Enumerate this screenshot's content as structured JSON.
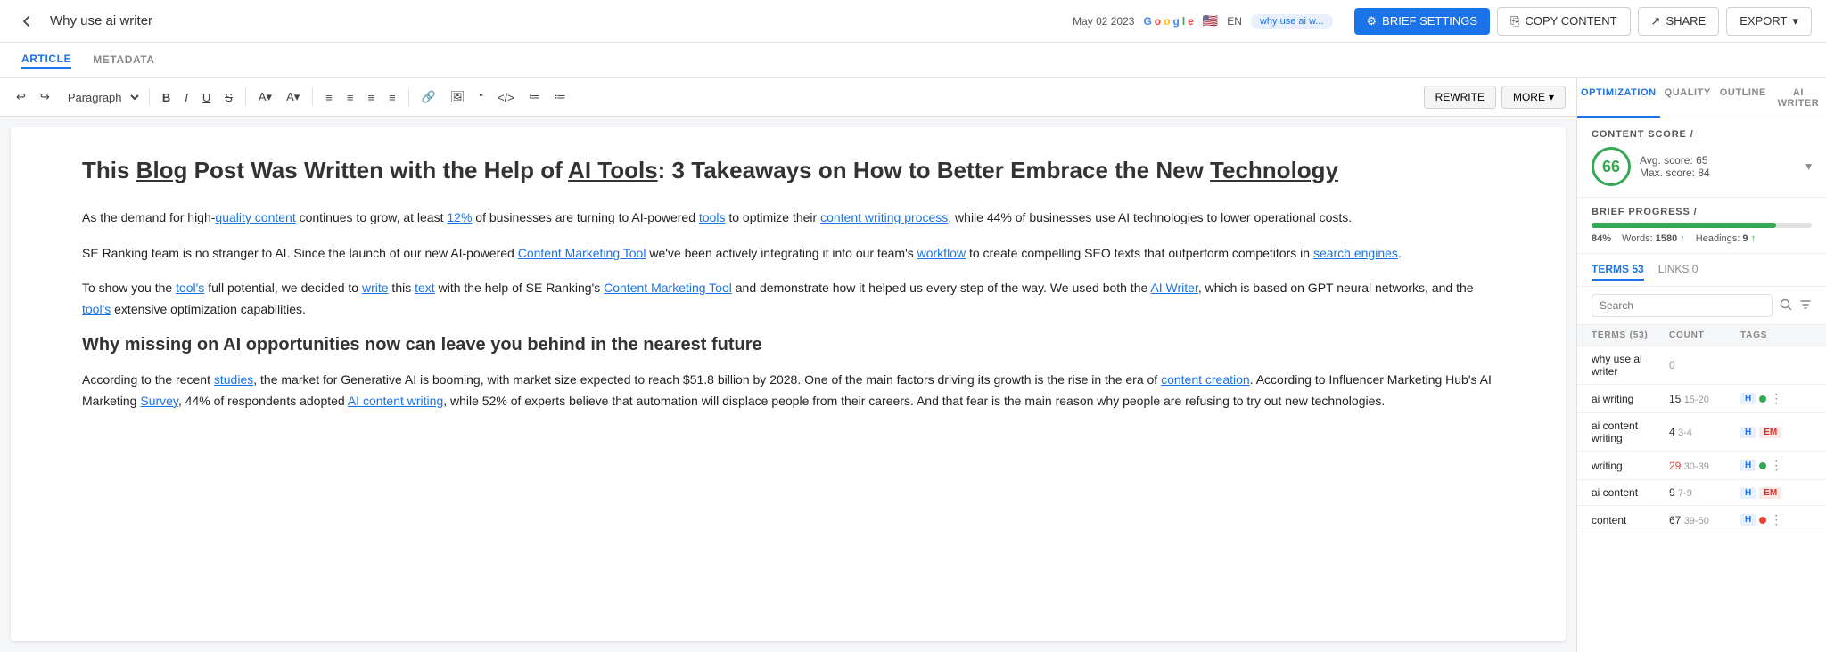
{
  "topbar": {
    "back_icon": "←",
    "title": "Why use ai writer",
    "date": "May 02 2023",
    "search_engine": "Google",
    "country": "USA",
    "language": "EN",
    "keyword": "why use ai w...",
    "btn_brief": "BRIEF SETTINGS",
    "btn_copy": "COPY CONTENT",
    "btn_share": "SHARE",
    "btn_export": "EXPORT"
  },
  "tabs": {
    "article": "ARTICLE",
    "metadata": "METADATA"
  },
  "toolbar": {
    "paragraph": "Paragraph",
    "bold": "B",
    "italic": "I",
    "underline": "U",
    "strikethrough": "S",
    "rewrite": "REWRITE",
    "more": "MORE"
  },
  "article": {
    "title": "This Blog Post Was Written with the Help of AI Tools: 3 Takeaways on How to Better Embrace the New Technology",
    "p1": "As the demand for high-quality content continues to grow, at least 12% of businesses are turning to AI-powered tools to optimize their content writing process, while 44% of businesses use AI technologies to lower operational costs.",
    "p2": "SE Ranking team is no stranger to AI. Since the launch of our new AI-powered Content Marketing Tool we've been actively integrating it into our team's workflow to create compelling SEO texts that outperform competitors in search engines.",
    "p3": "To show you the tool's full potential, we decided to write this text with the help of SE Ranking's Content Marketing Tool and demonstrate how it helped us every step of the way. We used both the AI Writer, which is based on GPT neural networks, and the tool's extensive optimization capabilities.",
    "h2": "Why missing on AI opportunities now can leave you behind in the nearest future",
    "p4": "According to the recent studies, the market for Generative AI is booming, with market size expected to reach $51.8 billion by 2028. One of the main factors driving its growth is the rise in the era of content creation. According to Influencer Marketing Hub's AI Marketing Survey, 44% of respondents adopted AI content writing, while 52% of experts believe that automation will displace people from their careers. And that fear is the main reason why people are refusing to try out new technologies."
  },
  "sidebar": {
    "tabs": [
      "OPTIMIZATION",
      "QUALITY",
      "OUTLINE",
      "AI WRITER"
    ],
    "content_score_label": "CONTENT SCORE /",
    "score_value": "66",
    "avg_score": "Avg. score: 65",
    "max_score": "Max. score: 84",
    "brief_progress_label": "BRIEF PROGRESS /",
    "progress_pct": 84,
    "progress_pct_label": "84%",
    "words_label": "Words: 1580",
    "headings_label": "Headings: 9",
    "terms_count": "53",
    "links_count": "0",
    "terms_tab": "TERMS 53",
    "links_tab": "LINKS 0",
    "search_placeholder": "Search",
    "table_headers": {
      "terms": "TERMS (53)",
      "count": "COUNT",
      "tags": "TAGS"
    },
    "rows": [
      {
        "term": "why use ai writer",
        "count": "0",
        "count_range": "",
        "tags": [],
        "highlight": "zero"
      },
      {
        "term": "ai writing",
        "count": "15",
        "count_range": "15-20",
        "tags": [
          "H"
        ],
        "has_more": true,
        "has_dot": true
      },
      {
        "term": "ai content writing",
        "count": "4",
        "count_range": "3-4",
        "tags": [
          "H",
          "EM"
        ],
        "has_more": false
      },
      {
        "term": "writing",
        "count": "29",
        "count_range": "30-39",
        "tags": [
          "H"
        ],
        "has_more": true,
        "has_dot": true
      },
      {
        "term": "ai content",
        "count": "9",
        "count_range": "7-9",
        "tags": [
          "H",
          "EM"
        ],
        "has_more": false
      },
      {
        "term": "content",
        "count": "67",
        "count_range": "39-50",
        "tags": [
          "H"
        ],
        "has_more": true,
        "has_dot_red": true
      }
    ]
  }
}
